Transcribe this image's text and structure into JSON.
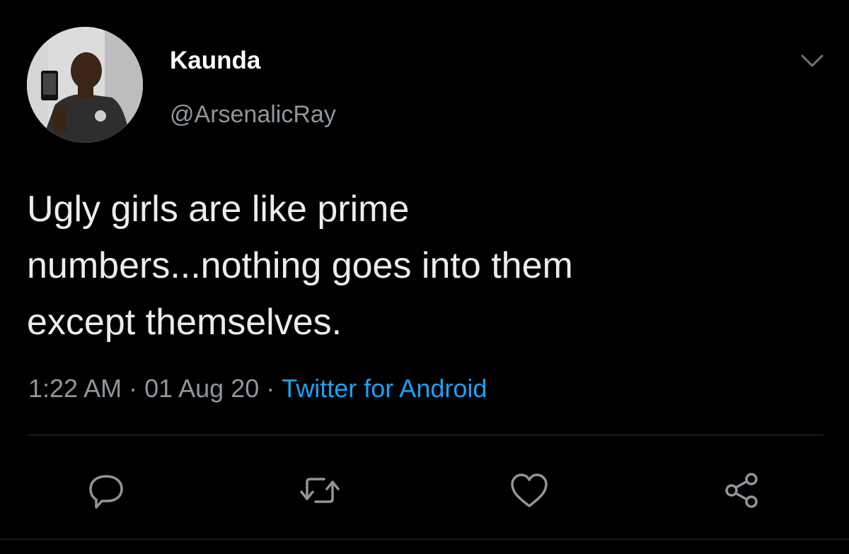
{
  "user": {
    "display_name": "Kaunda",
    "handle": "@ArsenalicRay",
    "avatar_icon": "profile-photo"
  },
  "tweet": {
    "lines": [
      "Ugly girls are like prime",
      "numbers...nothing goes into them",
      "except themselves."
    ]
  },
  "meta": {
    "time": "1:22 AM",
    "separator": "·",
    "date": "01 Aug 20",
    "source": "Twitter for Android"
  },
  "actions": [
    {
      "name": "reply",
      "icon": "reply-icon"
    },
    {
      "name": "retweet",
      "icon": "retweet-icon"
    },
    {
      "name": "like",
      "icon": "heart-icon"
    },
    {
      "name": "share",
      "icon": "share-icon"
    }
  ],
  "colors": {
    "background": "#000000",
    "name": "#ffffff",
    "secondary": "#8f969c",
    "link": "#1da1f2",
    "icon": "#8f969c"
  }
}
